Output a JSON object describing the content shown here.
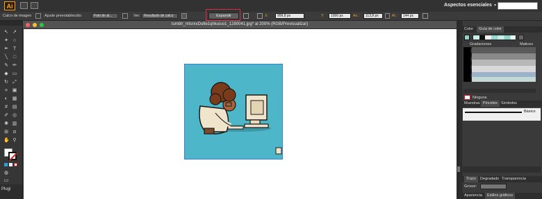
{
  "app": {
    "logo": "Ai",
    "workspace": "Aspectos esenciales",
    "workspace_caret": "▾"
  },
  "control": {
    "tool_name": "Calco de imagen",
    "preset_label": "Ajuste preestablecido:",
    "preset_value": "Foto de al...",
    "view_label": "Ver:",
    "view_value": "Resultado de calco",
    "expand_label": "Expandir",
    "x_label": "X:",
    "x_value": "999,8 px",
    "y_label": "Y:",
    "y_value": "1000 px",
    "w_label": "An.:",
    "w_value": "113,8 px",
    "h_label": "Al.:",
    "h_value": "144 px"
  },
  "document": {
    "title": "tumblr_mtsrxxDu8e1qhkuiuo1_1280041.jpg* al 200% (RGB/Previsualizar)"
  },
  "tools_panel": {
    "plugin_label": "Plugi"
  },
  "right_panel": {
    "tab_color": "Color",
    "tab_guide": "Guía de color",
    "gradations": "Gradaciones",
    "shades": "Matices",
    "none_label": "Ninguna",
    "tab_swatches": "Muestras",
    "tab_brushes": "Pinceles",
    "tab_symbols": "Símbolos",
    "brush_basic": "Básico",
    "tab_stroke": "Trazo",
    "tab_gradient": "Degradado",
    "tab_transparency": "Transparencia",
    "weight_label": "Grosor:",
    "tab_appearance": "Apariencia",
    "tab_graphic_styles": "Estilos gráficos"
  },
  "colors": {
    "accent": "#f7a21b",
    "highlight": "#d32f46",
    "art_bg": "#4db6c9"
  }
}
